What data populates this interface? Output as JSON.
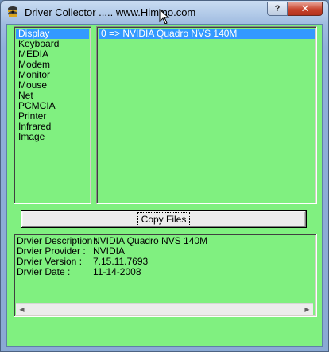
{
  "window": {
    "title": "Driver Collector ..... www.Himmo.com",
    "help_label": "?",
    "close_label": "✕"
  },
  "categories": [
    {
      "label": "Display",
      "selected": true
    },
    {
      "label": "Keyboard"
    },
    {
      "label": "MEDIA"
    },
    {
      "label": "Modem"
    },
    {
      "label": "Monitor"
    },
    {
      "label": "Mouse"
    },
    {
      "label": "Net"
    },
    {
      "label": "PCMCIA"
    },
    {
      "label": "Printer"
    },
    {
      "label": "Infrared"
    },
    {
      "label": "Image"
    }
  ],
  "drivers": [
    {
      "label": "0 => NVIDIA Quadro NVS 140M",
      "selected": true
    }
  ],
  "copy_button": {
    "label": "Copy Files"
  },
  "details": {
    "rows": [
      {
        "label": "Drvier Description :",
        "value": "NVIDIA Quadro NVS 140M"
      },
      {
        "label": "Drvier Provider :",
        "value": "NVIDIA"
      },
      {
        "label": "Drvier Version :",
        "value": "7.15.11.7693"
      },
      {
        "label": "Drvier Date :",
        "value": "11-14-2008"
      }
    ]
  },
  "icons": {
    "app": "app-icon",
    "cursor": "mouse-cursor-icon",
    "scroll_left": "scroll-left-arrow-icon",
    "scroll_right": "scroll-right-arrow-icon"
  },
  "colors": {
    "client_background": "#80f080",
    "selection": "#3399ff",
    "close_button": "#c7432c"
  }
}
